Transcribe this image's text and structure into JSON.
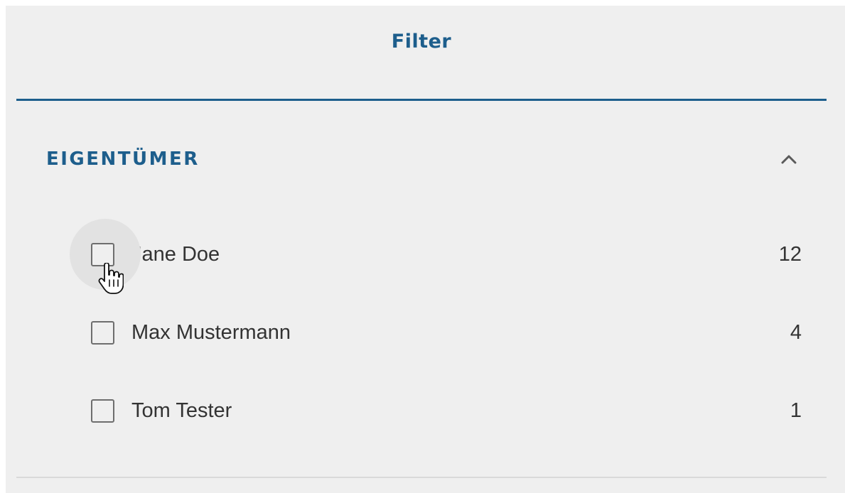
{
  "tab": {
    "title": "Filter"
  },
  "section": {
    "title": "EIGENTÜMER",
    "expanded": true,
    "toggle_icon": "chevron-up-icon"
  },
  "options": [
    {
      "label": "Jane Doe",
      "count": "12",
      "checked": false,
      "hovered": true
    },
    {
      "label": "Max Mustermann",
      "count": "4",
      "checked": false,
      "hovered": false
    },
    {
      "label": "Tom Tester",
      "count": "1",
      "checked": false,
      "hovered": false
    }
  ],
  "colors": {
    "accent": "#1d5e8c",
    "panel_background": "#efefef",
    "text": "#333333",
    "checkbox_border": "#6e6e6e"
  },
  "cursor_icon": "hand-pointer-icon"
}
